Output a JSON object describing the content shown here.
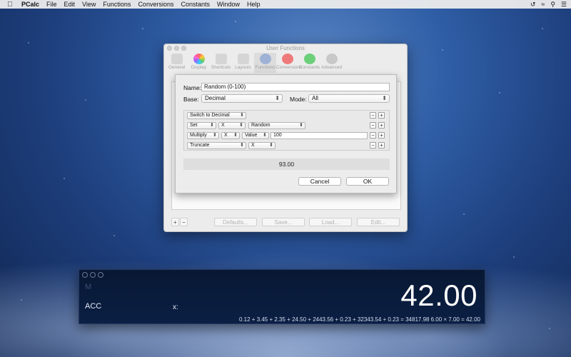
{
  "menubar": {
    "apple_icon": "apple-icon",
    "items": [
      "PCalc",
      "File",
      "Edit",
      "View",
      "Functions",
      "Conversions",
      "Constants",
      "Window",
      "Help"
    ],
    "status_icons": [
      "time-machine-icon",
      "wifi-icon",
      "search-icon",
      "list-icon"
    ]
  },
  "prefs": {
    "title": "User Functions",
    "toolbar": [
      {
        "label": "General",
        "icon": "general-icon"
      },
      {
        "label": "Display",
        "icon": "display-color-wheel-icon"
      },
      {
        "label": "Shortcuts",
        "icon": "keyboard-icon"
      },
      {
        "label": "Layouts",
        "icon": "layouts-grid-icon"
      },
      {
        "label": "Functions",
        "icon": "functions-icon"
      },
      {
        "label": "Conversions",
        "icon": "conversions-icon"
      },
      {
        "label": "Constants",
        "icon": "constants-icon"
      },
      {
        "label": "Advanced",
        "icon": "gear-icon"
      }
    ],
    "selected_tab": "Functions",
    "bottom": {
      "add": "+",
      "remove": "−",
      "defaults": "Defaults...",
      "save": "Save...",
      "load": "Load...",
      "edit": "Edit..."
    }
  },
  "sheet": {
    "name_label": "Name:",
    "name_value": "Random (0-100)",
    "base_label": "Base:",
    "base_value": "Decimal",
    "mode_label": "Mode:",
    "mode_value": "All",
    "steps": [
      {
        "op": "Switch to Decimal"
      },
      {
        "op": "Set",
        "reg": "X",
        "arg": "Random"
      },
      {
        "op": "Multiply",
        "reg": "X",
        "arg": "Value",
        "value": "100"
      },
      {
        "op": "Truncate",
        "reg": "X"
      }
    ],
    "minus": "−",
    "plus": "+",
    "result": "93.00",
    "cancel": "Cancel",
    "ok": "OK"
  },
  "calc": {
    "memory_label": "M",
    "acc_label": "ACC",
    "x_label": "x:",
    "display": "42.00",
    "tape_left": "0.12 + 3.45 + 2.35 + 24.50 + 2443.56 + 0.23 + 32343.54 + 0.23 = 34817.98",
    "tape_right": "6.00 × 7.00 = 42.00"
  }
}
